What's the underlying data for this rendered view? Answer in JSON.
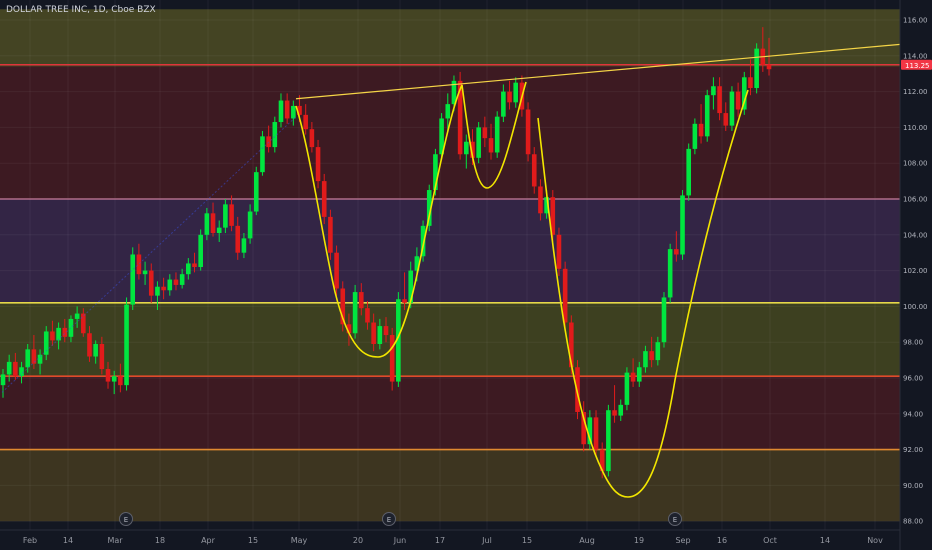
{
  "header": {
    "title": "DOLLAR TREE INC, 1D, Cboe BZX"
  },
  "colors": {
    "background": "#131722",
    "up": "#00e640",
    "down": "#e01b1b",
    "cup_curve": "#f2e600",
    "trendline": "#f5d547",
    "last_price_tag": "#f23645"
  },
  "chart_data": {
    "type": "candlestick",
    "title": "DOLLAR TREE INC, 1D, Cboe BZX",
    "ylim": [
      88,
      117
    ],
    "y_ticks": [
      "88.00",
      "90.00",
      "92.00",
      "94.00",
      "96.00",
      "98.00",
      "100.00",
      "102.00",
      "104.00",
      "106.00",
      "108.00",
      "110.00",
      "112.00",
      "114.00",
      "116.00"
    ],
    "x_ticks": [
      "Feb",
      "14",
      "Mar",
      "18",
      "Apr",
      "15",
      "May",
      "20",
      "Jun",
      "17",
      "Jul",
      "15",
      "Aug",
      "19",
      "Sep",
      "16",
      "Oct",
      "14",
      "Nov"
    ],
    "last_price": "113.25",
    "zones": [
      {
        "from": 113.4,
        "to": 116.6,
        "fill": "#444423"
      },
      {
        "from": 106.0,
        "to": 113.4,
        "fill": "#3d1a22"
      },
      {
        "from": 100.2,
        "to": 106.0,
        "fill": "#332545"
      },
      {
        "from": 96.1,
        "to": 100.2,
        "fill": "#3d4020"
      },
      {
        "from": 92.0,
        "to": 96.1,
        "fill": "#3d1a22"
      },
      {
        "from": 88.0,
        "to": 92.0,
        "fill": "#3d3520"
      }
    ],
    "levels": [
      {
        "price": 113.5,
        "color": "#e0343b"
      },
      {
        "price": 106.0,
        "color": "#b06d8a"
      },
      {
        "price": 100.2,
        "color": "#e6d84a"
      },
      {
        "price": 96.1,
        "color": "#e04a2a"
      },
      {
        "price": 92.0,
        "color": "#e08a30"
      }
    ],
    "earnings_markers": [
      "E",
      "E",
      "E"
    ],
    "candles": [
      [
        95.6,
        96.5,
        94.9,
        96.2
      ],
      [
        96.2,
        97.3,
        95.8,
        96.9
      ],
      [
        96.9,
        97.4,
        95.9,
        96.1
      ],
      [
        96.1,
        96.9,
        95.7,
        96.6
      ],
      [
        96.6,
        97.9,
        96.3,
        97.6
      ],
      [
        97.6,
        98.4,
        96.5,
        96.8
      ],
      [
        96.8,
        97.6,
        96.2,
        97.3
      ],
      [
        97.3,
        98.9,
        97.0,
        98.6
      ],
      [
        98.6,
        99.2,
        97.8,
        98.1
      ],
      [
        98.1,
        99.1,
        97.6,
        98.8
      ],
      [
        98.8,
        99.3,
        98.0,
        98.3
      ],
      [
        98.3,
        99.5,
        98.0,
        99.3
      ],
      [
        99.3,
        100.0,
        98.8,
        99.6
      ],
      [
        99.6,
        99.9,
        98.3,
        98.5
      ],
      [
        98.5,
        98.9,
        96.9,
        97.2
      ],
      [
        97.2,
        98.1,
        96.8,
        97.9
      ],
      [
        97.9,
        98.3,
        96.2,
        96.5
      ],
      [
        96.5,
        96.9,
        95.4,
        95.8
      ],
      [
        95.8,
        96.4,
        95.1,
        96.1
      ],
      [
        96.1,
        96.8,
        95.2,
        95.6
      ],
      [
        95.6,
        100.5,
        95.3,
        100.1
      ],
      [
        100.1,
        103.3,
        99.8,
        102.9
      ],
      [
        102.9,
        103.5,
        101.5,
        101.8
      ],
      [
        101.8,
        102.5,
        101.2,
        102.0
      ],
      [
        102.0,
        102.4,
        100.2,
        100.6
      ],
      [
        100.6,
        101.4,
        99.8,
        101.1
      ],
      [
        101.1,
        101.6,
        100.4,
        100.9
      ],
      [
        100.9,
        101.8,
        100.6,
        101.5
      ],
      [
        101.5,
        101.9,
        100.9,
        101.2
      ],
      [
        101.2,
        102.1,
        101.0,
        101.8
      ],
      [
        101.8,
        102.7,
        101.5,
        102.4
      ],
      [
        102.4,
        103.0,
        101.9,
        102.2
      ],
      [
        102.2,
        104.3,
        102.0,
        104.0
      ],
      [
        104.0,
        105.5,
        103.7,
        105.2
      ],
      [
        105.2,
        105.8,
        103.9,
        104.1
      ],
      [
        104.1,
        104.8,
        103.6,
        104.4
      ],
      [
        104.4,
        106.0,
        104.1,
        105.7
      ],
      [
        105.7,
        106.2,
        104.2,
        104.5
      ],
      [
        104.5,
        105.0,
        102.6,
        103.0
      ],
      [
        103.0,
        104.1,
        102.7,
        103.8
      ],
      [
        103.8,
        105.7,
        103.5,
        105.3
      ],
      [
        105.3,
        107.8,
        105.1,
        107.5
      ],
      [
        107.5,
        109.8,
        107.3,
        109.5
      ],
      [
        109.5,
        110.1,
        108.6,
        108.9
      ],
      [
        108.9,
        110.6,
        108.6,
        110.3
      ],
      [
        110.3,
        111.9,
        110.0,
        111.5
      ],
      [
        111.5,
        111.9,
        110.2,
        110.5
      ],
      [
        110.5,
        111.5,
        110.1,
        111.2
      ],
      [
        111.2,
        111.8,
        110.3,
        110.7
      ],
      [
        110.7,
        111.3,
        109.6,
        109.9
      ],
      [
        109.9,
        110.3,
        108.6,
        108.9
      ],
      [
        108.9,
        109.3,
        106.6,
        107.0
      ],
      [
        107.0,
        107.4,
        104.6,
        105.0
      ],
      [
        105.0,
        105.4,
        102.6,
        103.0
      ],
      [
        103.0,
        103.4,
        100.6,
        101.0
      ],
      [
        101.0,
        101.4,
        98.6,
        99.0
      ],
      [
        99.0,
        99.6,
        97.8,
        98.5
      ],
      [
        98.5,
        101.2,
        98.2,
        100.8
      ],
      [
        100.8,
        101.3,
        99.5,
        99.9
      ],
      [
        99.9,
        100.3,
        98.7,
        99.1
      ],
      [
        99.1,
        99.6,
        97.5,
        97.9
      ],
      [
        97.9,
        99.3,
        97.6,
        98.9
      ],
      [
        98.9,
        99.4,
        98.0,
        98.4
      ],
      [
        98.4,
        98.8,
        95.3,
        95.8
      ],
      [
        95.8,
        100.8,
        95.5,
        100.4
      ],
      [
        100.4,
        101.9,
        99.8,
        100.2
      ],
      [
        100.2,
        102.5,
        99.9,
        102.0
      ],
      [
        102.0,
        103.3,
        101.4,
        102.8
      ],
      [
        102.8,
        104.8,
        102.5,
        104.5
      ],
      [
        104.5,
        106.8,
        104.2,
        106.5
      ],
      [
        106.5,
        108.8,
        106.2,
        108.5
      ],
      [
        108.5,
        110.8,
        108.2,
        110.5
      ],
      [
        110.5,
        111.9,
        109.8,
        111.3
      ],
      [
        111.3,
        112.9,
        110.9,
        112.6
      ],
      [
        112.6,
        113.1,
        108.2,
        108.5
      ],
      [
        108.5,
        109.6,
        107.7,
        109.2
      ],
      [
        109.2,
        109.9,
        107.9,
        108.3
      ],
      [
        108.3,
        110.3,
        108.0,
        110.0
      ],
      [
        110.0,
        110.6,
        108.9,
        109.4
      ],
      [
        109.4,
        110.2,
        108.2,
        108.6
      ],
      [
        108.6,
        110.9,
        108.3,
        110.6
      ],
      [
        110.6,
        112.4,
        110.3,
        112.0
      ],
      [
        112.0,
        112.6,
        111.0,
        111.4
      ],
      [
        111.4,
        112.8,
        111.1,
        112.5
      ],
      [
        112.5,
        112.9,
        110.6,
        111.0
      ],
      [
        111.0,
        111.4,
        108.1,
        108.5
      ],
      [
        108.5,
        108.9,
        106.3,
        106.7
      ],
      [
        106.7,
        107.1,
        104.8,
        105.2
      ],
      [
        105.2,
        106.5,
        104.9,
        106.1
      ],
      [
        106.1,
        106.5,
        103.6,
        104.0
      ],
      [
        104.0,
        104.4,
        101.7,
        102.1
      ],
      [
        102.1,
        102.5,
        98.7,
        99.1
      ],
      [
        99.1,
        99.5,
        96.2,
        96.6
      ],
      [
        96.6,
        97.0,
        93.7,
        94.1
      ],
      [
        94.1,
        94.7,
        91.9,
        92.3
      ],
      [
        92.3,
        94.2,
        92.0,
        93.8
      ],
      [
        93.8,
        94.2,
        91.6,
        92.0
      ],
      [
        92.0,
        92.4,
        90.4,
        90.8
      ],
      [
        90.8,
        94.5,
        90.5,
        94.2
      ],
      [
        94.2,
        95.6,
        93.5,
        93.9
      ],
      [
        93.9,
        94.8,
        93.6,
        94.5
      ],
      [
        94.5,
        96.6,
        94.2,
        96.3
      ],
      [
        96.3,
        97.1,
        95.5,
        95.8
      ],
      [
        95.8,
        96.9,
        95.5,
        96.6
      ],
      [
        96.6,
        97.8,
        96.3,
        97.5
      ],
      [
        97.5,
        98.3,
        96.6,
        97.0
      ],
      [
        97.0,
        98.3,
        96.7,
        98.0
      ],
      [
        98.0,
        100.8,
        97.7,
        100.5
      ],
      [
        100.5,
        103.5,
        100.2,
        103.2
      ],
      [
        103.2,
        104.2,
        102.5,
        102.9
      ],
      [
        102.9,
        106.5,
        102.6,
        106.2
      ],
      [
        106.2,
        109.1,
        105.9,
        108.8
      ],
      [
        108.8,
        110.5,
        108.5,
        110.2
      ],
      [
        110.2,
        111.3,
        109.1,
        109.5
      ],
      [
        109.5,
        112.1,
        109.2,
        111.8
      ],
      [
        111.8,
        112.8,
        111.0,
        112.3
      ],
      [
        112.3,
        112.8,
        110.4,
        110.8
      ],
      [
        110.8,
        111.4,
        109.8,
        110.1
      ],
      [
        110.1,
        112.3,
        109.8,
        112.0
      ],
      [
        112.0,
        112.5,
        110.6,
        111.0
      ],
      [
        111.0,
        113.1,
        110.7,
        112.8
      ],
      [
        112.8,
        113.8,
        111.8,
        112.2
      ],
      [
        112.2,
        114.7,
        111.9,
        114.4
      ],
      [
        114.4,
        115.6,
        113.1,
        113.5
      ],
      [
        113.5,
        115.0,
        112.9,
        113.25
      ]
    ]
  }
}
